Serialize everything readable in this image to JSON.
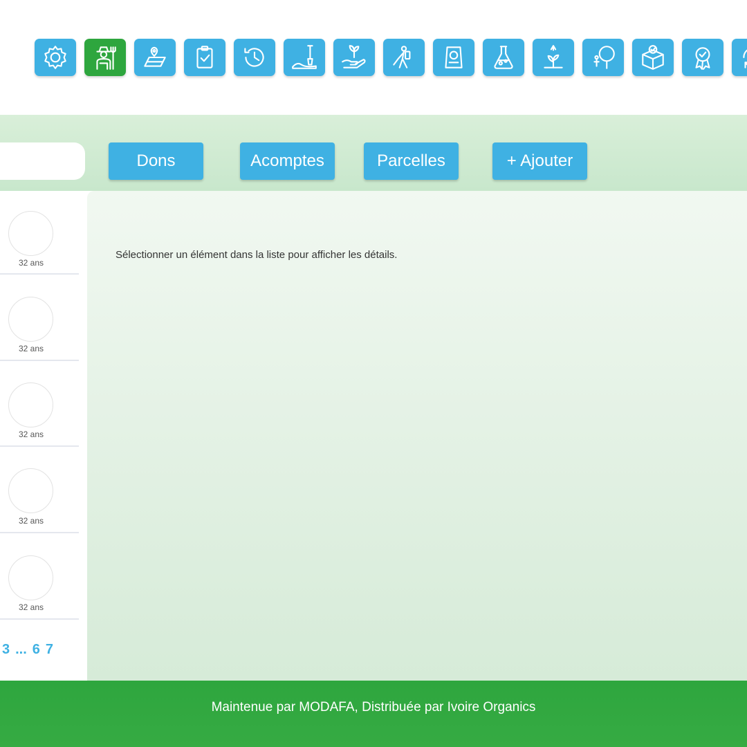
{
  "toolbar_icons": [
    {
      "name": "settings-icon",
      "active": false
    },
    {
      "name": "farmer-icon",
      "active": true
    },
    {
      "name": "map-location-icon",
      "active": false
    },
    {
      "name": "clipboard-check-icon",
      "active": false
    },
    {
      "name": "history-icon",
      "active": false
    },
    {
      "name": "soil-shovel-icon",
      "active": false
    },
    {
      "name": "hand-plant-icon",
      "active": false
    },
    {
      "name": "sprayer-worker-icon",
      "active": false
    },
    {
      "name": "fertilizer-bag-icon",
      "active": false
    },
    {
      "name": "lab-flask-icon",
      "active": false
    },
    {
      "name": "seedling-sprinkler-icon",
      "active": false
    },
    {
      "name": "tree-harvest-icon",
      "active": false
    },
    {
      "name": "box-check-icon",
      "active": false
    },
    {
      "name": "certificate-badge-icon",
      "active": false
    },
    {
      "name": "sync-icon",
      "active": false
    }
  ],
  "search": {
    "value": "",
    "placeholder": ""
  },
  "actions": {
    "dons": "Dons",
    "acomptes": "Acomptes",
    "parcelles": "Parcelles",
    "ajouter": "+ Ajouter"
  },
  "list": {
    "items": [
      {
        "age": "32 ans"
      },
      {
        "age": "32 ans"
      },
      {
        "age": "32 ans"
      },
      {
        "age": "32 ans"
      },
      {
        "age": "32 ans"
      }
    ],
    "pagination": [
      "3",
      "...",
      "6",
      "7"
    ]
  },
  "details": {
    "message": "Sélectionner un élément dans la liste pour afficher les détails."
  },
  "footer": {
    "text": "Maintenue par MODAFA, Distribuée par Ivoire Organics"
  },
  "colors": {
    "accent_blue": "#3fb1e3",
    "brand_green": "#2ea63e"
  }
}
